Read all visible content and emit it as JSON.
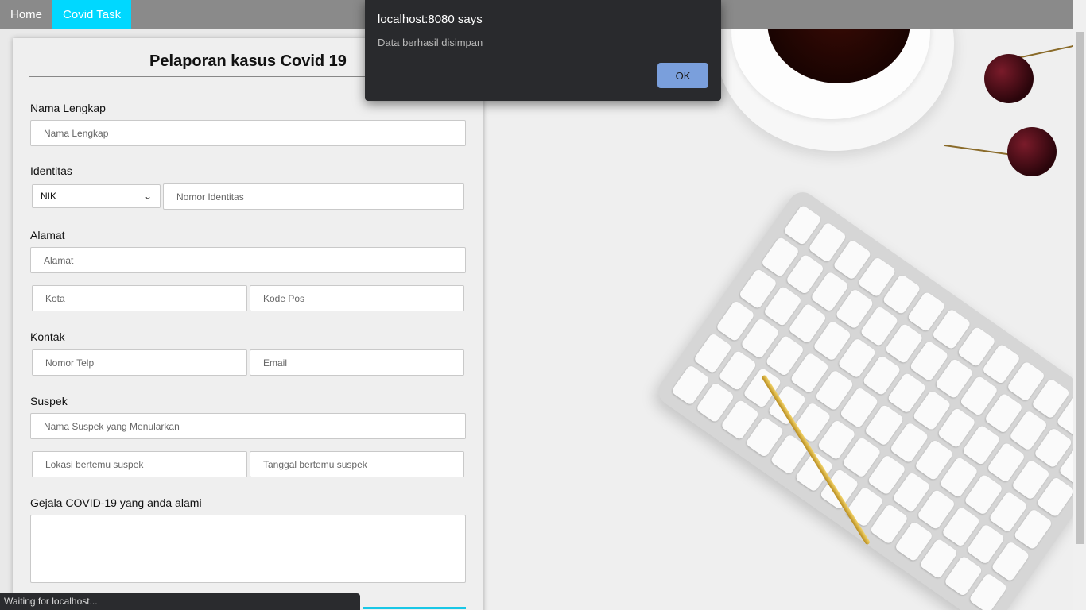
{
  "navbar": {
    "items": [
      {
        "label": "Home"
      },
      {
        "label": "Covid Task"
      }
    ],
    "active_color": "#00d8ff"
  },
  "form": {
    "title": "Pelaporan kasus Covid 19",
    "nama_label": "Nama Lengkap",
    "nama_placeholder": "Nama Lengkap",
    "identitas_label": "Identitas",
    "identitas_type": "NIK",
    "identitas_placeholder": "Nomor Identitas",
    "alamat_label": "Alamat",
    "alamat_placeholder": "Alamat",
    "kota_placeholder": "Kota",
    "kodepos_placeholder": "Kode Pos",
    "kontak_label": "Kontak",
    "telp_placeholder": "Nomor Telp",
    "email_placeholder": "Email",
    "suspek_label": "Suspek",
    "suspek_nama_placeholder": "Nama Suspek yang Menularkan",
    "suspek_lokasi_placeholder": "Lokasi bertemu suspek",
    "suspek_tanggal_placeholder": "Tanggal bertemu suspek",
    "gejala_label": "Gejala COVID-19 yang anda alami"
  },
  "dialog": {
    "title": "localhost:8080 says",
    "message": "Data berhasil disimpan",
    "ok_label": "OK"
  },
  "status_bar": {
    "text": "Waiting for localhost..."
  }
}
